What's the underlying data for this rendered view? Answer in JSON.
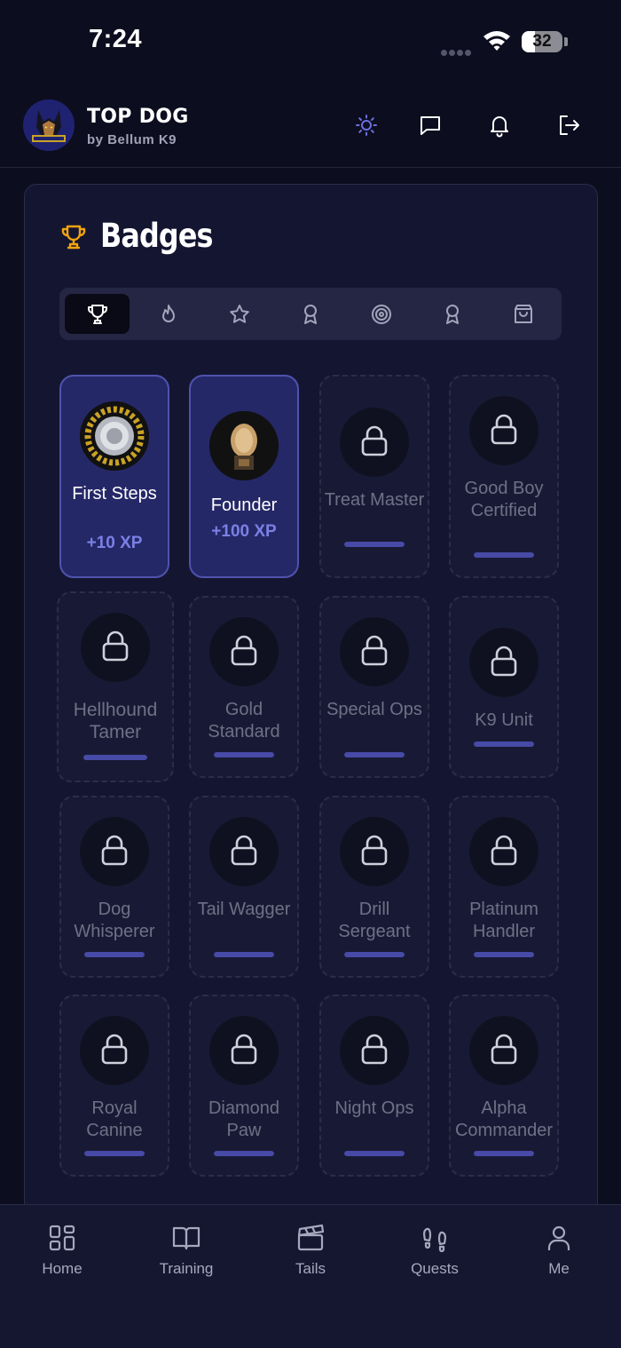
{
  "status_bar": {
    "time": "7:24",
    "battery": "32",
    "battery_level": 0.32
  },
  "header": {
    "title": "TOP DOG",
    "subtitle": "by Bellum K9",
    "logo_text": "Bellum K9",
    "icons": [
      "sun-icon",
      "chat-icon",
      "bell-icon",
      "logout-icon"
    ]
  },
  "badges": {
    "title": "Badges",
    "tabs": [
      {
        "icon": "trophy-icon",
        "active": true
      },
      {
        "icon": "flame-icon",
        "active": false
      },
      {
        "icon": "star-icon",
        "active": false
      },
      {
        "icon": "ribbon-icon",
        "active": false
      },
      {
        "icon": "target-icon",
        "active": false
      },
      {
        "icon": "medal-icon",
        "active": false
      },
      {
        "icon": "shopping-bag-icon",
        "active": false
      }
    ],
    "items": [
      {
        "name": "First Steps",
        "xp": "+10 XP",
        "unlocked": true
      },
      {
        "name": "Founder",
        "xp": "+100 XP",
        "unlocked": true
      },
      {
        "name": "Treat Master",
        "unlocked": false,
        "progress": 0
      },
      {
        "name": "Good Boy Certified",
        "unlocked": false,
        "progress": 0
      },
      {
        "name": "Hellhound Tamer",
        "unlocked": false,
        "progress": 0
      },
      {
        "name": "Gold Standard",
        "unlocked": false,
        "progress": 0
      },
      {
        "name": "Special Ops",
        "unlocked": false,
        "progress": 0
      },
      {
        "name": "K9 Unit",
        "unlocked": false,
        "progress": 0
      },
      {
        "name": "Dog Whisperer",
        "unlocked": false,
        "progress": 0
      },
      {
        "name": "Tail Wagger",
        "unlocked": false,
        "progress": 0
      },
      {
        "name": "Drill Sergeant",
        "unlocked": false,
        "progress": 0
      },
      {
        "name": "Platinum Handler",
        "unlocked": false,
        "progress": 0
      },
      {
        "name": "Royal Canine",
        "unlocked": false,
        "progress": 0
      },
      {
        "name": "Diamond Paw",
        "unlocked": false,
        "progress": 0
      },
      {
        "name": "Night Ops",
        "unlocked": false,
        "progress": 0
      },
      {
        "name": "Alpha Commander",
        "unlocked": false,
        "progress": 0
      }
    ]
  },
  "nav": {
    "items": [
      {
        "label": "Home",
        "icon": "home-grid-icon"
      },
      {
        "label": "Training",
        "icon": "book-icon"
      },
      {
        "label": "Tails",
        "icon": "clapperboard-icon"
      },
      {
        "label": "Quests",
        "icon": "footprints-icon"
      },
      {
        "label": "Me",
        "icon": "user-icon"
      }
    ]
  },
  "colors": {
    "background": "#0c0d1e",
    "accent": "#7c80e4",
    "trophy": "#f2a30f",
    "sun_icon": "#6b6fe0"
  }
}
